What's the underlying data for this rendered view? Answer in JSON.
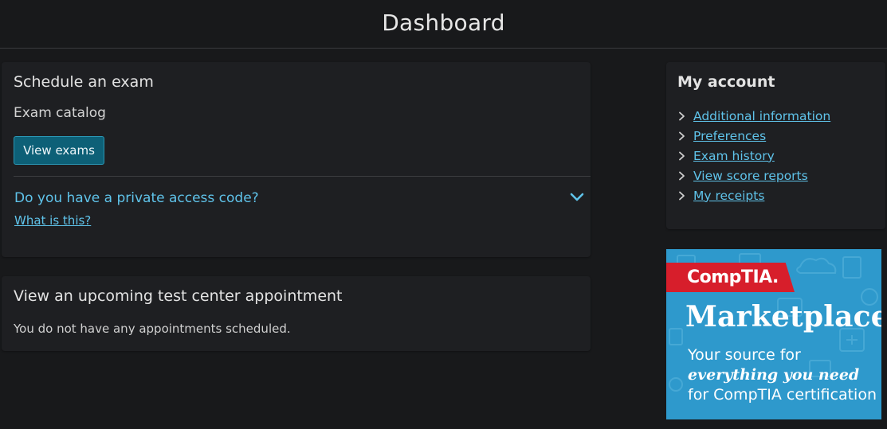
{
  "header": {
    "title": "Dashboard"
  },
  "schedule": {
    "title": "Schedule an exam",
    "catalog_label": "Exam catalog",
    "view_exams_button": "View exams",
    "access_code_question": "Do you have a private access code?",
    "what_is_this_link": "What is this?"
  },
  "appointment": {
    "title": "View an upcoming test center appointment",
    "empty_text": "You do not have any appointments scheduled."
  },
  "account": {
    "title": "My account",
    "links": [
      {
        "label": "Additional information"
      },
      {
        "label": "Preferences"
      },
      {
        "label": "Exam history"
      },
      {
        "label": "View score reports"
      },
      {
        "label": "My receipts"
      }
    ]
  },
  "ad": {
    "logo": "CompTIA.",
    "title": "Marketplace",
    "line1": "Your source for",
    "line2": "everything you need",
    "line3": "for CompTIA certification",
    "colors": {
      "background": "#2e99cc",
      "logo_red": "#d71e2b"
    }
  },
  "icons": {
    "access_toggle": "chevron-down-icon",
    "account_link_bullet": "chevron-right-icon"
  },
  "colors": {
    "page_bg": "#18191b",
    "panel_bg": "#1e1f22",
    "link": "#5fc3ea",
    "button_bg": "#0d6077"
  }
}
